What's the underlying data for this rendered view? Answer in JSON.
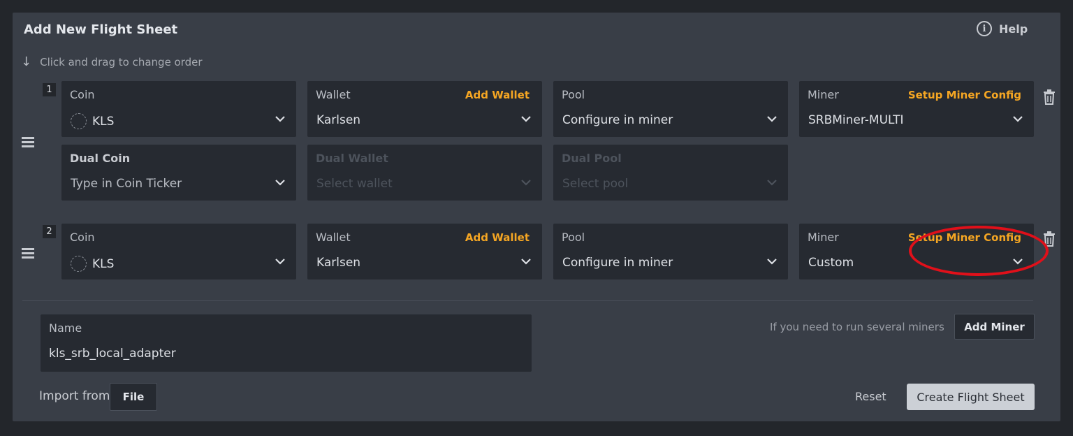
{
  "header": {
    "title": "Add New Flight Sheet",
    "help_label": "Help",
    "help_icon_glyph": "i"
  },
  "hint": "Click and drag to change order",
  "rows": [
    {
      "index": "1",
      "coin": {
        "label": "Coin",
        "value": "KLS"
      },
      "wallet": {
        "label": "Wallet",
        "action": "Add Wallet",
        "value": "Karlsen"
      },
      "pool": {
        "label": "Pool",
        "value": "Configure in miner"
      },
      "miner": {
        "label": "Miner",
        "action": "Setup Miner Config",
        "value": "SRBMiner-MULTI"
      },
      "dual_coin": {
        "label": "Dual Coin",
        "value": "Type in Coin Ticker"
      },
      "dual_wallet": {
        "label": "Dual Wallet",
        "value": "Select wallet"
      },
      "dual_pool": {
        "label": "Dual Pool",
        "value": "Select pool"
      }
    },
    {
      "index": "2",
      "coin": {
        "label": "Coin",
        "value": "KLS"
      },
      "wallet": {
        "label": "Wallet",
        "action": "Add Wallet",
        "value": "Karlsen"
      },
      "pool": {
        "label": "Pool",
        "value": "Configure in miner"
      },
      "miner": {
        "label": "Miner",
        "action": "Setup Miner Config",
        "value": "Custom"
      }
    }
  ],
  "name_field": {
    "label": "Name",
    "value": "kls_srb_local_adapter"
  },
  "several_miners_hint": "If you need to run several miners",
  "add_miner_label": "Add Miner",
  "import_label": "Import from",
  "file_button_label": "File",
  "reset_label": "Reset",
  "create_label": "Create Flight Sheet",
  "colors": {
    "accent": "#f5a623",
    "highlight": "#e0101a",
    "panel": "#393e47",
    "field": "#262a31"
  }
}
